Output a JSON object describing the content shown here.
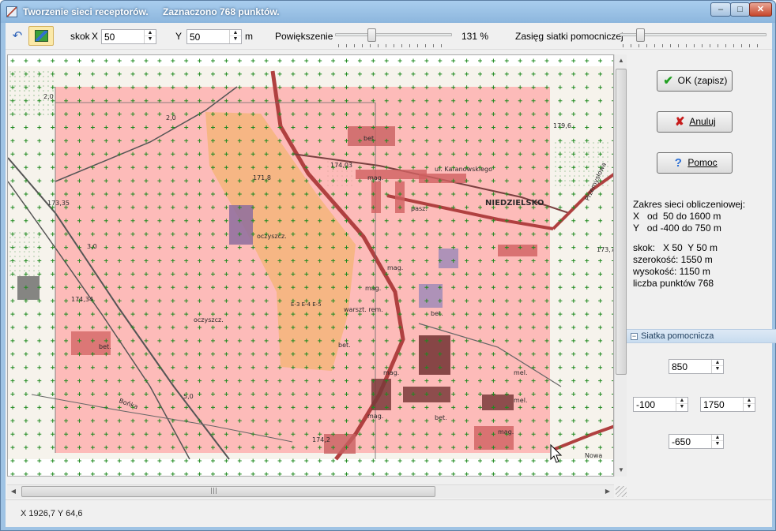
{
  "window": {
    "title": "Tworzenie sieci receptorów.",
    "subtitle": "Zaznaczono 768 punktów.",
    "min_glyph": "–",
    "max_glyph": "□",
    "close_glyph": "✕"
  },
  "toolbar": {
    "undo_icon": "↶",
    "skok_label": "skok",
    "x_label": "X",
    "x_value": "50",
    "y_label": "Y",
    "y_value": "50",
    "unit": "m",
    "zoom_label": "Powiększenie",
    "zoom_value": "131 %",
    "zoom_level": 0.3,
    "grid_range_label": "Zasięg siatki pomocniczej",
    "grid_range_level": 0.12
  },
  "map": {
    "labels": {
      "district": "NIEDZIELSKO",
      "street1": "ul. Karanowskiego",
      "street2": "Przemysłowa",
      "street3": "Nowa",
      "street4": "Bońka",
      "h1": "179,6",
      "h2": "173,35",
      "h3": "174,03",
      "h4": "171,8",
      "h5": "173,7",
      "h6": "174,34",
      "h7": "2,0",
      "h8": "2,0",
      "h9": "3,0",
      "h10": "5,0",
      "h11": "174,2",
      "b1": "bet.",
      "b2": "mag.",
      "b3": "pasz.",
      "b4": "oczyszcz.",
      "b5": "mag.",
      "b6": "warszt. rem.",
      "b7": "bet.",
      "b8": "mag.",
      "b9": "mag.",
      "b10": "bet.",
      "b11": "mel.",
      "b12": "bet.",
      "b13": "mag.",
      "b14": "oczyszcz.",
      "b15": "bet.",
      "b16": "mag.",
      "b17": "E-3 E-4 E-5",
      "b18": "mel."
    }
  },
  "buttons": {
    "ok_icon": "✔",
    "ok_label": "OK (zapisz)",
    "cancel_icon": "✘",
    "cancel_label": "Anuluj",
    "help_icon": "?",
    "help_label": "Pomoc"
  },
  "info": {
    "header": "Zakres sieci obliczeniowej:",
    "x_range": "X   od  50 do 1600 m",
    "y_range": "Y   od -400 do 750 m",
    "step": "skok:   X 50  Y 50 m",
    "width": "szerokość: 1550 m",
    "height": "wysokość: 1150 m",
    "count": "liczba punktów 768"
  },
  "helper_grid": {
    "section_label": "Siatka pomocnicza",
    "collapse_glyph": "−",
    "top": "850",
    "left": "-100",
    "right": "1750",
    "bottom": "-650"
  },
  "status": {
    "coords": "X 1926,7 Y 64,6"
  }
}
